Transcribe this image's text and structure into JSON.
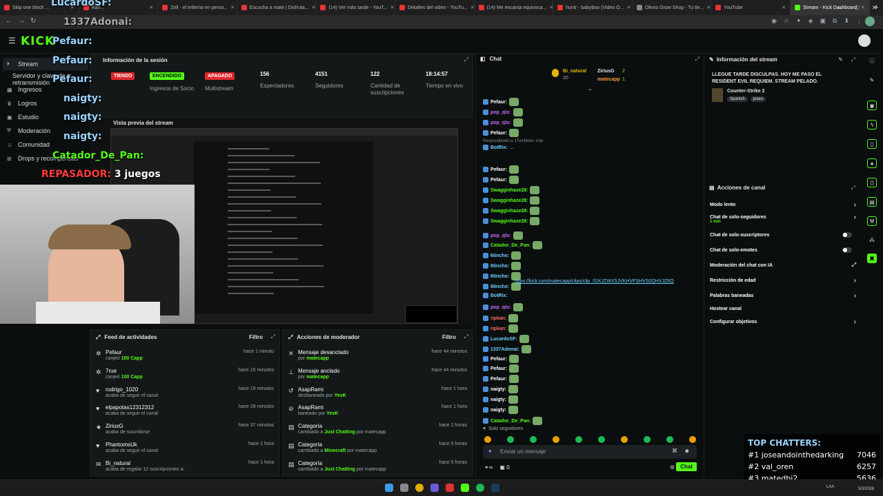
{
  "browser": {
    "tabs": [
      {
        "label": "Skip one block ..."
      },
      {
        "label": "Ran..."
      },
      {
        "label": "Zell - el infierno en perso..."
      },
      {
        "label": "Escucha a mate | Disfruta..."
      },
      {
        "label": "(14) Ver más tarde - YouT..."
      },
      {
        "label": "Detalles del video - YouTu..."
      },
      {
        "label": "(14) Me encanta equivoca..."
      },
      {
        "label": "huntr - babyboo (Video O..."
      },
      {
        "label": "Olivos Grow Shop - Tu tie..."
      },
      {
        "label": "YouTube"
      },
      {
        "label": "Stream - Kick Dashboard"
      }
    ],
    "add_tab": "+",
    "window_controls": [
      "—",
      "□",
      "✕"
    ]
  },
  "header": {
    "logo": "KICK"
  },
  "sidebar": {
    "items": [
      {
        "label": "Stream",
        "icon": "play-icon"
      },
      {
        "label": "Servidor y clave de retransmisión",
        "icon": "server-icon"
      },
      {
        "label": "Ingresos",
        "icon": "money-icon"
      },
      {
        "label": "Logros",
        "icon": "trophy-icon"
      },
      {
        "label": "Estudio",
        "icon": "studio-icon"
      },
      {
        "label": "Moderación",
        "icon": "shield-icon"
      },
      {
        "label": "Comunidad",
        "icon": "community-icon"
      },
      {
        "label": "Drops y recompensas",
        "icon": "gift-icon"
      }
    ]
  },
  "session": {
    "title": "Información de la sesión",
    "stats": [
      {
        "value": "TIENDO",
        "label": "",
        "color": "#e0282c"
      },
      {
        "value": "ENCENDIDO",
        "label": "Ingresos de Socio",
        "color": "#53fc18"
      },
      {
        "value": "APAGADO",
        "label": "Multistream",
        "color": "#e0282c"
      },
      {
        "value": "156",
        "label": "Espectadores"
      },
      {
        "value": "4151",
        "label": "Seguidores"
      },
      {
        "value": "122",
        "label": "Cantidad de suscripciones"
      },
      {
        "value": "18:14:57",
        "label": "Tiempo en vivo"
      }
    ]
  },
  "preview": {
    "title": "Vista previa del stream"
  },
  "overlay_chat": [
    {
      "user": "LucardoSF:"
    },
    {
      "user": "1337Adonai:"
    },
    {
      "user": "Pefaur:"
    },
    {
      "user": "Pefaur:"
    },
    {
      "user": "Pefaur:"
    },
    {
      "user": "naigty:"
    },
    {
      "user": "naigty:"
    },
    {
      "user": "naigty:"
    },
    {
      "user": "Catador_De_Pan:"
    },
    {
      "user": "REPASADOR:",
      "text": "3 juegos"
    }
  ],
  "activity_feed": {
    "title": "Feed de actividades",
    "filter": "Filtro",
    "rows": [
      {
        "name": "Pefaur",
        "action": "canjeó",
        "highlight": "100 Capp",
        "time": "hace 1 minuto",
        "icon": "points-icon"
      },
      {
        "name": "7rue",
        "action": "canjeó",
        "highlight": "100 Capp",
        "time": "hace 15 minutos",
        "icon": "points-icon"
      },
      {
        "name": "rodrigo_1020",
        "action": "acaba de seguir el canal",
        "highlight": "",
        "time": "hace 19 minutos",
        "icon": "heart-icon"
      },
      {
        "name": "elpapotas12312312",
        "action": "acaba de seguir el canal",
        "highlight": "",
        "time": "hace 28 minutos",
        "icon": "heart-icon"
      },
      {
        "name": "ZiriusG",
        "action": "acaba de suscribirse",
        "highlight": "",
        "time": "hace 37 minutos",
        "icon": "star-icon"
      },
      {
        "name": "PhantomsUk",
        "action": "acaba de seguir el canal",
        "highlight": "",
        "time": "hace 1 hora",
        "icon": "heart-icon"
      },
      {
        "name": "Bi_natural",
        "action": "acaba de regalar 12 suscripciones a:",
        "highlight": "",
        "time": "hace 1 hora",
        "icon": "gift-icon"
      }
    ]
  },
  "mod_actions": {
    "title": "Acciones de moderador",
    "filter": "Filtro",
    "rows": [
      {
        "name": "Mensaje desanclado",
        "action": "por",
        "highlight": "matecapp",
        "time": "hace 44 minutos",
        "icon": "unpin-icon"
      },
      {
        "name": "Mensaje anclado",
        "action": "por",
        "highlight": "matecapp",
        "time": "hace 44 minutos",
        "icon": "pin-icon"
      },
      {
        "name": "AsapRami",
        "action": "desbaneado por",
        "highlight": "YesK",
        "time": "hace 1 hora",
        "icon": "unban-icon"
      },
      {
        "name": "AsapRami",
        "action": "baneado por",
        "highlight": "YesK",
        "time": "hace 1 hora",
        "icon": "ban-icon"
      },
      {
        "name": "Categoría",
        "action": "cambiado a",
        "highlight": "Just Chatting",
        "extra": "por matecapp",
        "time": "hace 2 horas",
        "icon": "category-icon"
      },
      {
        "name": "Categoría",
        "action": "cambiado a",
        "highlight": "Minecraft",
        "extra": "por matecapp",
        "time": "hace 5 horas",
        "icon": "category-icon"
      },
      {
        "name": "Categoría",
        "action": "cambiado a",
        "highlight": "Just Chatting",
        "extra": "por matecapp",
        "time": "hace 5 horas",
        "icon": "category-icon"
      }
    ]
  },
  "chat": {
    "title": "Chat",
    "top_users": [
      {
        "name": "Bi_natural",
        "count": "20"
      },
      {
        "name": "ZiriusG",
        "count": "2"
      },
      {
        "name": "matecapp",
        "count": "1"
      }
    ],
    "reply_note": "Respondiendo a 1Tomlikolo: lclip",
    "clip_url": "https://kick.com/matecapp/clips/clip_01KJZWX5JVKHVFSHVS0QHXJZ6Q",
    "messages": [
      {
        "user": "Pefaur:",
        "color": "#ffffff"
      },
      {
        "user": "pop_qlo:",
        "color": "#c86bff"
      },
      {
        "user": "pop_qlo:",
        "color": "#c86bff"
      },
      {
        "user": "Pefaur:",
        "color": "#ffffff"
      },
      {
        "user": "BotRix:",
        "color": "#6fd0ff",
        "text": "..."
      },
      {
        "user": "Pefaur:",
        "color": "#ffffff"
      },
      {
        "user": "Pefaur:",
        "color": "#ffffff"
      },
      {
        "user": "Swagginhaze28:",
        "color": "#53fc18"
      },
      {
        "user": "Swagginhaze28:",
        "color": "#53fc18"
      },
      {
        "user": "Swagginhaze28:",
        "color": "#53fc18"
      },
      {
        "user": "Swagginhaze28:",
        "color": "#53fc18"
      },
      {
        "user": "pop_qlo:",
        "color": "#c86bff"
      },
      {
        "user": "Catador_De_Pan:",
        "color": "#53fc18"
      },
      {
        "user": "6tincho:",
        "color": "#6fd0ff"
      },
      {
        "user": "6tincho:",
        "color": "#6fd0ff"
      },
      {
        "user": "6tincho:",
        "color": "#6fd0ff"
      },
      {
        "user": "6tincho:",
        "color": "#6fd0ff"
      },
      {
        "user": "BotRix:",
        "color": "#6fd0ff",
        "link": true
      },
      {
        "user": "pop_qlo:",
        "color": "#c86bff"
      },
      {
        "user": "ripkan:",
        "color": "#ff6b6b"
      },
      {
        "user": "ripkan:",
        "color": "#ff6b6b"
      },
      {
        "user": "LucardoSF:",
        "color": "#6fd0ff"
      },
      {
        "user": "1337Adonai:",
        "color": "#6fd0ff"
      },
      {
        "user": "Pefaur:",
        "color": "#ffffff"
      },
      {
        "user": "Pefaur:",
        "color": "#ffffff"
      },
      {
        "user": "Pefaur:",
        "color": "#ffffff"
      },
      {
        "user": "naigty:",
        "color": "#ffffff"
      },
      {
        "user": "naigty:",
        "color": "#ffffff"
      },
      {
        "user": "naigty:",
        "color": "#ffffff"
      },
      {
        "user": "Catador_De_Pan:",
        "color": "#53fc18"
      },
      {
        "user": "REPASADOR:",
        "color": "#ff3b3b",
        "text": "3 juegos"
      }
    ],
    "followers_only": "Solo seguidores",
    "input_placeholder": "Enviar un mensaje",
    "viewer_count": "0",
    "send_label": "Chat"
  },
  "stream_info": {
    "title": "Información del stream",
    "description": "LLEGUE TARDE DISCULPAS. HOY ME PASO EL RESIDENT EVIL REQUIEM. STREAM PELADO.",
    "category": "Counter-Strike 2",
    "tags": [
      "Spanish",
      "joseo"
    ]
  },
  "channel_actions": {
    "title": "Acciones de canal",
    "rows": [
      {
        "label": "Modo lento",
        "control": "chevron"
      },
      {
        "label": "Chat de solo-seguidores",
        "sub": "1 min",
        "control": "chevron"
      },
      {
        "label": "Chat de solo-suscriptores",
        "control": "toggle"
      },
      {
        "label": "Chat de solo-emotes",
        "control": "toggle"
      },
      {
        "label": "Moderación del chat con IA",
        "control": "external"
      },
      {
        "label": "Restricción de edad",
        "control": "chevron"
      },
      {
        "label": "Palabras baneadas",
        "control": "chevron"
      },
      {
        "label": "Hostear canal",
        "control": "none"
      },
      {
        "label": "Configurar objetivos",
        "control": "chevron"
      }
    ]
  },
  "top_chatters": {
    "title": "TOP CHATTERS:",
    "rows": [
      {
        "rank": "#1",
        "name": "joseandointhedarking",
        "count": "7046"
      },
      {
        "rank": "#2",
        "name": "val_oren",
        "count": "6257"
      },
      {
        "rank": "#3",
        "name": "matedbi2",
        "count": "5636"
      }
    ]
  },
  "taskbar": {
    "lang": "LAA",
    "date": "5/3/2026"
  },
  "colors": {
    "accent": "#53fc18",
    "bg": "#0b0e0f",
    "panel": "#141819",
    "danger": "#e0282c"
  }
}
